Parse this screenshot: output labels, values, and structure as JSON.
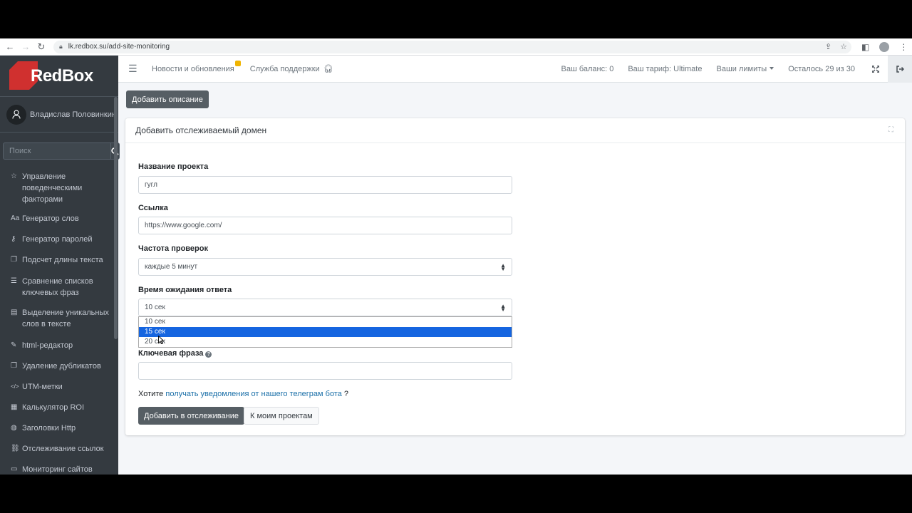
{
  "browser": {
    "url": "lk.redbox.su/add-site-monitoring"
  },
  "brand": {
    "name": "RedBox"
  },
  "user": {
    "name": "Владислав Половинкин"
  },
  "search": {
    "placeholder": "Поиск"
  },
  "sidebar": {
    "items": [
      {
        "label": "Управление поведенческими факторами",
        "icon": "star-icon",
        "glyph": "☆"
      },
      {
        "label": "Генератор слов",
        "icon": "font-icon",
        "glyph": "Aa"
      },
      {
        "label": "Генератор паролей",
        "icon": "key-icon",
        "glyph": "⚷"
      },
      {
        "label": "Подсчет длины текста",
        "icon": "copy-icon",
        "glyph": "❐"
      },
      {
        "label": "Сравнение списков ключевых фраз",
        "icon": "list-icon",
        "glyph": "☰"
      },
      {
        "label": "Выделение уникальных слов в тексте",
        "icon": "book-icon",
        "glyph": "▤"
      },
      {
        "label": "html-редактор",
        "icon": "edit-icon",
        "glyph": "✎"
      },
      {
        "label": "Удаление дубликатов",
        "icon": "clone-icon",
        "glyph": "❐"
      },
      {
        "label": "UTM-метки",
        "icon": "code-icon",
        "glyph": "</>"
      },
      {
        "label": "Калькулятор ROI",
        "icon": "calculator-icon",
        "glyph": "▦"
      },
      {
        "label": "Заголовки Http",
        "icon": "globe-icon",
        "glyph": "◍"
      },
      {
        "label": "Отслеживание ссылок",
        "icon": "link-icon",
        "glyph": "⛓"
      },
      {
        "label": "Мониторинг сайтов",
        "icon": "desktop-icon",
        "glyph": "▭"
      }
    ]
  },
  "topnav": {
    "news": "Новости и обновления",
    "support": "Служба поддержки",
    "balance": "Ваш баланс: 0",
    "tariff": "Ваш тариф: Ultimate",
    "limits": "Ваши лимиты",
    "remaining": "Осталось 29 из 30"
  },
  "content": {
    "add_description_button": "Добавить описание",
    "card_title": "Добавить отслеживаемый домен",
    "project_name_label": "Название проекта",
    "project_name_value": "гугл",
    "link_label": "Ссылка",
    "link_value": "https://www.google.com/",
    "frequency_label": "Частота проверок",
    "frequency_value": "каждые 5 минут",
    "timeout_label": "Время ожидания ответа",
    "timeout_value": "10 сек",
    "timeout_options": [
      "10 сек",
      "15 сек",
      "20 сек"
    ],
    "timeout_highlighted": "15 сек",
    "keyphrase_label": "Ключевая фраза",
    "keyphrase_value": "",
    "telegram_prefix": "Хотите",
    "telegram_link": "получать уведомления от нашего телеграм бота",
    "telegram_suffix": "?",
    "add_tracking_button": "Добавить в отслеживание",
    "my_projects_button": "К моим проектам"
  },
  "colors": {
    "sidebar_bg": "#343a40",
    "brand_red": "#d0302f",
    "selection_blue": "#1565e0",
    "link_blue": "#1a6fa8",
    "button_dark": "#565e64"
  }
}
